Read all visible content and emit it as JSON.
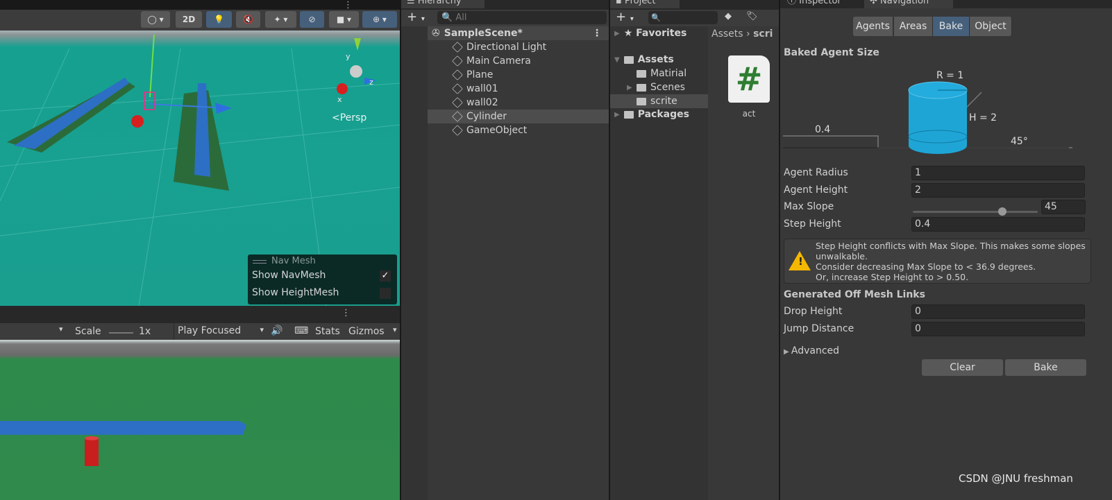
{
  "scene_toolbar": {
    "btn_2d": "2D",
    "icons": [
      "draw-mode-icon",
      "2d-toggle",
      "lighting-icon",
      "audio-mute-icon",
      "effects-icon",
      "visibility-icon",
      "camera-icon",
      "gizmos-icon"
    ]
  },
  "scene": {
    "persp_label": "<Persp",
    "axis": {
      "y": "y",
      "x": "x",
      "z": "z"
    },
    "colors": {
      "ground": "#17a091",
      "sky": "#9fa3a5",
      "wall": "#2d6fc4"
    }
  },
  "navmesh_overlay": {
    "title": "Nav Mesh",
    "items": [
      {
        "label": "Show NavMesh",
        "checked": true
      },
      {
        "label": "Show HeightMesh",
        "checked": false
      }
    ]
  },
  "game_toolbar": {
    "scale_label": "Scale",
    "scale_value": "1x",
    "play_mode": "Play Focused",
    "stats": "Stats",
    "gizmos": "Gizmos"
  },
  "hierarchy": {
    "tab": "Hierarchy",
    "search_placeholder": "All",
    "scene": "SampleScene*",
    "items": [
      "Directional Light",
      "Main Camera",
      "Plane",
      "wall01",
      "wall02",
      "Cylinder",
      "GameObject"
    ],
    "selected": "Cylinder"
  },
  "project": {
    "tab": "Project",
    "favorites": "Favorites",
    "assets": "Assets",
    "folders": [
      "Matirial",
      "Scenes",
      "scrite"
    ],
    "packages": "Packages",
    "breadcrumb": [
      "Assets",
      "scri"
    ],
    "file": "act"
  },
  "inspector": {
    "tab_inspector": "Inspector",
    "tab_navigation": "Navigation",
    "tabs": [
      "Agents",
      "Areas",
      "Bake",
      "Object"
    ],
    "active_tab": "Bake",
    "baked_title": "Baked Agent Size",
    "diagram": {
      "r": "R = 1",
      "h": "H = 2",
      "step": "0.4",
      "slope": "45°"
    },
    "fields": [
      {
        "label": "Agent Radius",
        "value": "1"
      },
      {
        "label": "Agent Height",
        "value": "2"
      },
      {
        "label": "Max Slope",
        "value": "45",
        "slider_max": 60
      },
      {
        "label": "Step Height",
        "value": "0.4"
      }
    ],
    "warning": [
      "Step Height conflicts with Max Slope. This makes some slopes unwalkable.",
      "Consider decreasing Max Slope to < 36.9 degrees.",
      "Or, increase Step Height to > 0.50."
    ],
    "offmesh_title": "Generated Off Mesh Links",
    "offmesh": [
      {
        "label": "Drop Height",
        "value": "0"
      },
      {
        "label": "Jump Distance",
        "value": "0"
      }
    ],
    "advanced": "Advanced",
    "clear": "Clear",
    "bake": "Bake"
  },
  "watermark": "CSDN @JNU freshman"
}
